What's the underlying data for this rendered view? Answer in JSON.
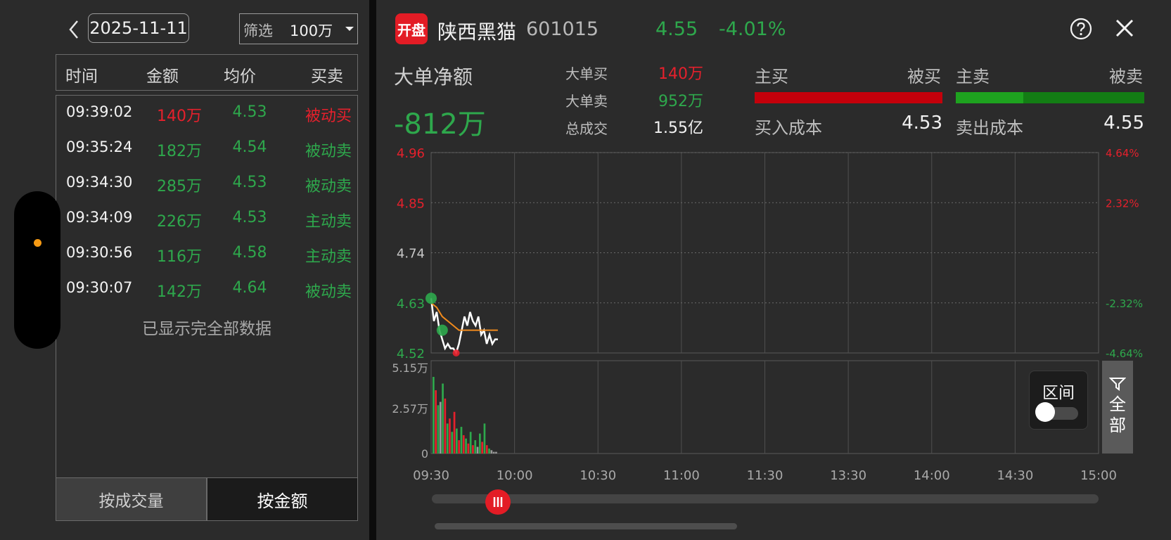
{
  "left": {
    "date": "2025-11-11",
    "filter_label": "筛选",
    "filter_value": "100万",
    "headers": [
      "时间",
      "金额",
      "均价",
      "买卖"
    ],
    "rows": [
      {
        "time": "09:39:02",
        "amount": "140万",
        "avg": "4.53",
        "type": "被动买",
        "color": "red"
      },
      {
        "time": "09:35:24",
        "amount": "182万",
        "avg": "4.54",
        "type": "被动卖",
        "color": "green"
      },
      {
        "time": "09:34:30",
        "amount": "285万",
        "avg": "4.53",
        "type": "被动卖",
        "color": "green"
      },
      {
        "time": "09:34:09",
        "amount": "226万",
        "avg": "4.53",
        "type": "主动卖",
        "color": "green"
      },
      {
        "time": "09:30:56",
        "amount": "116万",
        "avg": "4.58",
        "type": "主动卖",
        "color": "green"
      },
      {
        "time": "09:30:07",
        "amount": "142万",
        "avg": "4.64",
        "type": "被动卖",
        "color": "green"
      }
    ],
    "done_text": "已显示完全部数据",
    "btn_volume": "按成交量",
    "btn_amount": "按金额"
  },
  "header": {
    "logo": "开盘",
    "name": "陕西黑猫",
    "code": "601015",
    "price": "4.55",
    "change_pct": "-4.01%"
  },
  "summary": {
    "net_label": "大单净额",
    "net_value": "-812万",
    "big_buy_label": "大单买",
    "big_buy_value": "140万",
    "big_sell_label": "大单卖",
    "big_sell_value": "952万",
    "total_label": "总成交",
    "total_value": "1.55亿",
    "active_buy": "主买",
    "passive_buy": "被买",
    "active_sell": "主卖",
    "passive_sell": "被卖",
    "buy_cost_label": "买入成本",
    "buy_cost_value": "4.53",
    "sell_cost_label": "卖出成本",
    "sell_cost_value": "4.55"
  },
  "controls": {
    "range_label": "区间",
    "all_label_1": "全",
    "all_label_2": "部"
  },
  "colors": {
    "up": "#e5202c",
    "down": "#2ea84c",
    "avg_line": "#f08a1c",
    "price_line": "#ffffff"
  },
  "chart_data": [
    {
      "type": "line",
      "y_ticks": [
        "4.96",
        "4.85",
        "4.74",
        "4.63",
        "4.52"
      ],
      "y_tick_colors": [
        "red",
        "red",
        "neutral",
        "green",
        "green"
      ],
      "right_ticks": [
        "4.64%",
        "2.32%",
        "-2.32%",
        "-4.64%"
      ],
      "right_tick_colors": [
        "red",
        "red",
        "green",
        "green"
      ],
      "x_ticks": [
        "09:30",
        "10:00",
        "10:30",
        "11:00",
        "11:30",
        "13:30",
        "14:00",
        "14:30",
        "15:00"
      ],
      "ylim": [
        4.52,
        4.96
      ],
      "series": [
        {
          "color": "#ffffff",
          "x_min": [
            0,
            1,
            2,
            3,
            4,
            5,
            6,
            7,
            8,
            9,
            10,
            11,
            12,
            13,
            14,
            15,
            16,
            17,
            18,
            19,
            20,
            21,
            22,
            23,
            24
          ],
          "values": [
            4.64,
            4.59,
            4.61,
            4.57,
            4.55,
            4.53,
            4.54,
            4.53,
            4.53,
            4.52,
            4.54,
            4.57,
            4.6,
            4.58,
            4.61,
            4.59,
            4.58,
            4.6,
            4.56,
            4.57,
            4.54,
            4.56,
            4.54,
            4.55,
            4.55
          ]
        },
        {
          "color": "#f08a1c",
          "x_min": [
            0,
            2,
            4,
            6,
            8,
            10,
            12,
            14,
            16,
            18,
            20,
            22,
            24
          ],
          "values": [
            4.63,
            4.62,
            4.6,
            4.59,
            4.58,
            4.57,
            4.57,
            4.57,
            4.57,
            4.57,
            4.57,
            4.57,
            4.57
          ]
        }
      ],
      "markers": [
        {
          "x_min": 0,
          "value": 4.64,
          "color": "green"
        },
        {
          "x_min": 4,
          "value": 4.57,
          "color": "green"
        },
        {
          "x_min": 9,
          "value": 4.52,
          "color": "red"
        }
      ]
    },
    {
      "type": "bar",
      "y_ticks": [
        "5.15万",
        "2.57万",
        "0"
      ],
      "ylim": [
        0,
        5.15
      ],
      "unit": "万",
      "values": [
        4.6,
        3.8,
        2.9,
        3.1,
        4.2,
        3.3,
        1.8,
        2.1,
        1.3,
        2.5,
        1.5,
        0.8,
        1.6,
        1.1,
        0.9,
        0.6,
        1.3,
        0.5,
        0.8,
        0.4,
        1.2,
        0.7,
        1.8,
        0.5,
        0.3,
        0.2,
        0.1,
        0.1
      ],
      "colors": [
        "green",
        "red",
        "green",
        "grey",
        "green",
        "red",
        "green",
        "red",
        "green",
        "red",
        "green",
        "red",
        "green",
        "red",
        "green",
        "red",
        "green",
        "red",
        "green",
        "grey",
        "green",
        "red",
        "green",
        "red",
        "green",
        "grey",
        "grey",
        "grey"
      ]
    }
  ]
}
